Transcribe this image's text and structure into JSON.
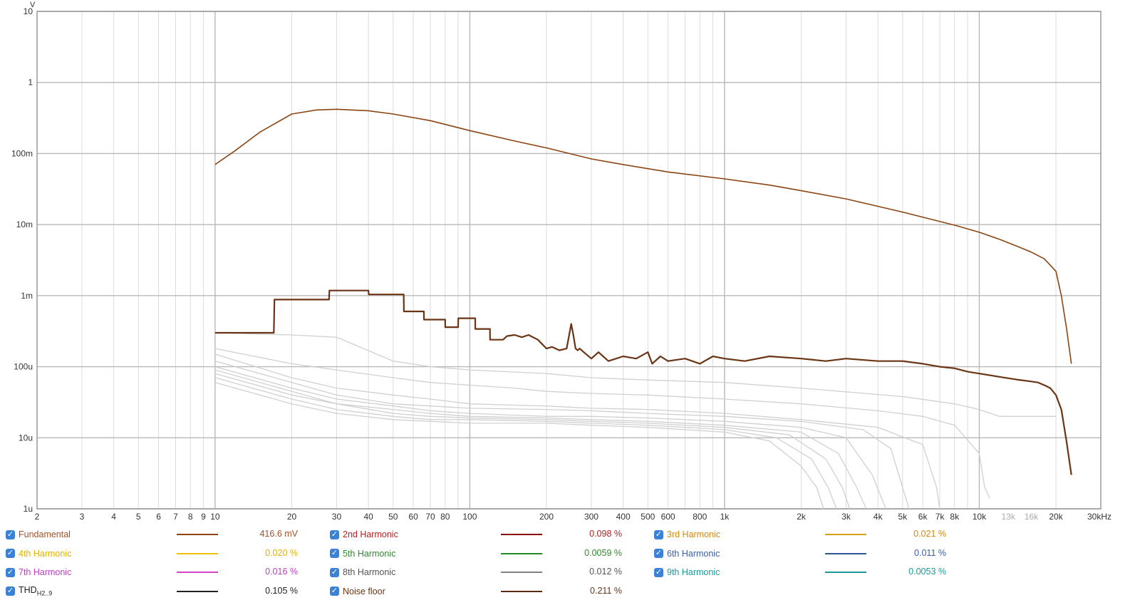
{
  "chart_data": {
    "type": "line",
    "x_scale": "log",
    "y_scale": "log",
    "xlim": [
      2,
      30000
    ],
    "ylim": [
      1e-06,
      10
    ],
    "y_unit_label": "V",
    "y_ticks": [
      {
        "v": 10,
        "label": "10"
      },
      {
        "v": 1,
        "label": "1"
      },
      {
        "v": 0.1,
        "label": "100m"
      },
      {
        "v": 0.01,
        "label": "10m"
      },
      {
        "v": 0.001,
        "label": "1m"
      },
      {
        "v": 0.0001,
        "label": "100u"
      },
      {
        "v": 1e-05,
        "label": "10u"
      },
      {
        "v": 1e-06,
        "label": "1u"
      }
    ],
    "x_ticks": [
      {
        "v": 2,
        "label": "2"
      },
      {
        "v": 3,
        "label": "3"
      },
      {
        "v": 4,
        "label": "4"
      },
      {
        "v": 5,
        "label": "5"
      },
      {
        "v": 6,
        "label": "6"
      },
      {
        "v": 7,
        "label": "7"
      },
      {
        "v": 8,
        "label": "8"
      },
      {
        "v": 9,
        "label": "9"
      },
      {
        "v": 10,
        "label": "10"
      },
      {
        "v": 20,
        "label": "20"
      },
      {
        "v": 30,
        "label": "30"
      },
      {
        "v": 40,
        "label": "40"
      },
      {
        "v": 50,
        "label": "50"
      },
      {
        "v": 60,
        "label": "60"
      },
      {
        "v": 70,
        "label": "70"
      },
      {
        "v": 80,
        "label": "80"
      },
      {
        "v": 100,
        "label": "100"
      },
      {
        "v": 200,
        "label": "200"
      },
      {
        "v": 300,
        "label": "300"
      },
      {
        "v": 400,
        "label": "400"
      },
      {
        "v": 500,
        "label": "500"
      },
      {
        "v": 600,
        "label": "600"
      },
      {
        "v": 800,
        "label": "800"
      },
      {
        "v": 1000,
        "label": "1k"
      },
      {
        "v": 2000,
        "label": "2k"
      },
      {
        "v": 3000,
        "label": "3k"
      },
      {
        "v": 4000,
        "label": "4k"
      },
      {
        "v": 5000,
        "label": "5k"
      },
      {
        "v": 6000,
        "label": "6k"
      },
      {
        "v": 7000,
        "label": "7k"
      },
      {
        "v": 8000,
        "label": "8k"
      },
      {
        "v": 10000,
        "label": "10k"
      },
      {
        "v": 13000,
        "label": "13k",
        "muted": true
      },
      {
        "v": 16000,
        "label": "16k",
        "muted": true
      },
      {
        "v": 20000,
        "label": "20k"
      },
      {
        "v": 30000,
        "label": "30kHz"
      }
    ],
    "grid": true,
    "series": [
      {
        "name": "Fundamental",
        "color": "#8b4513",
        "width": 1.6,
        "x": [
          10,
          12,
          15,
          20,
          25,
          30,
          40,
          50,
          70,
          100,
          150,
          200,
          300,
          400,
          600,
          1000,
          1500,
          2000,
          3000,
          5000,
          8000,
          10000,
          12000,
          14000,
          16000,
          18000,
          20000,
          21000,
          22000,
          23000
        ],
        "y": [
          0.07,
          0.11,
          0.2,
          0.36,
          0.41,
          0.42,
          0.4,
          0.36,
          0.29,
          0.21,
          0.15,
          0.12,
          0.084,
          0.07,
          0.055,
          0.044,
          0.036,
          0.03,
          0.023,
          0.015,
          0.0098,
          0.0078,
          0.0062,
          0.005,
          0.0041,
          0.0033,
          0.0022,
          0.001,
          0.00035,
          0.00011
        ]
      },
      {
        "name": "Noise floor",
        "color": "#6b3414",
        "width": 2.2,
        "x": [
          10,
          17,
          17.1,
          28,
          28.1,
          40,
          40.1,
          55,
          55.1,
          66,
          66.1,
          80,
          80.1,
          90,
          90.1,
          105,
          105.1,
          120,
          120.1,
          135,
          140,
          150,
          160,
          170,
          185,
          200,
          210,
          225,
          240,
          250,
          255,
          260,
          265,
          270,
          280,
          300,
          320,
          350,
          400,
          450,
          500,
          520,
          560,
          600,
          700,
          800,
          900,
          1000,
          1200,
          1500,
          2000,
          2500,
          3000,
          4000,
          5000,
          6000,
          7000,
          8000,
          9000,
          10000,
          12000,
          14000,
          16000,
          17000,
          18000,
          19000,
          20000,
          21000,
          22000,
          23000
        ],
        "y": [
          0.0003,
          0.0003,
          0.00088,
          0.00088,
          0.00118,
          0.00118,
          0.00104,
          0.00104,
          0.0006,
          0.0006,
          0.00046,
          0.00046,
          0.00036,
          0.00036,
          0.00048,
          0.00048,
          0.00034,
          0.00034,
          0.00024,
          0.00024,
          0.00027,
          0.00028,
          0.00026,
          0.00028,
          0.00024,
          0.00018,
          0.00019,
          0.00017,
          0.00018,
          0.0004,
          0.00028,
          0.00018,
          0.00017,
          0.00018,
          0.00016,
          0.00013,
          0.00016,
          0.00012,
          0.00014,
          0.00013,
          0.00016,
          0.00011,
          0.00014,
          0.00012,
          0.00013,
          0.00011,
          0.00014,
          0.00013,
          0.00012,
          0.00014,
          0.00013,
          0.00012,
          0.00013,
          0.00012,
          0.00012,
          0.00011,
          0.0001,
          9.5e-05,
          8.5e-05,
          8e-05,
          7.2e-05,
          6.6e-05,
          6.2e-05,
          6e-05,
          5.5e-05,
          5e-05,
          4e-05,
          2.5e-05,
          9e-06,
          3e-06
        ]
      },
      {
        "name": "2nd Harmonic",
        "color": "#d0d0d0",
        "width": 1.3,
        "x": [
          10,
          20,
          30,
          50,
          70,
          100,
          150,
          200,
          300,
          500,
          1000,
          2000,
          4000,
          6000,
          8000,
          10000,
          10500,
          11000
        ],
        "y": [
          0.00018,
          0.00011,
          9e-05,
          7e-05,
          6e-05,
          5.5e-05,
          5e-05,
          4.5e-05,
          4.2e-05,
          4e-05,
          3.5e-05,
          3e-05,
          2.4e-05,
          2e-05,
          1.5e-05,
          6e-06,
          2e-06,
          1.4e-06
        ]
      },
      {
        "name": "3rd Harmonic",
        "color": "#d0d0d0",
        "width": 1.3,
        "x": [
          10,
          20,
          30,
          50,
          70,
          100,
          200,
          300,
          500,
          1000,
          2000,
          4000,
          6000,
          6800,
          7000
        ],
        "y": [
          0.00015,
          7e-05,
          5e-05,
          4e-05,
          3.5e-05,
          3e-05,
          2.8e-05,
          2.6e-05,
          2.5e-05,
          2.2e-05,
          1.8e-05,
          1.4e-05,
          8e-06,
          2e-06,
          1e-06
        ]
      },
      {
        "name": "4th Harmonic",
        "color": "#d0d0d0",
        "width": 1.3,
        "x": [
          10,
          20,
          30,
          50,
          70,
          100,
          200,
          300,
          500,
          1000,
          2000,
          3500,
          4500,
          5000,
          5300
        ],
        "y": [
          0.00012,
          6e-05,
          4e-05,
          3e-05,
          2.8e-05,
          2.6e-05,
          2.5e-05,
          2.4e-05,
          2.2e-05,
          2e-05,
          1.7e-05,
          1.3e-05,
          7e-06,
          2e-06,
          1e-06
        ]
      },
      {
        "name": "5th Harmonic",
        "color": "#d0d0d0",
        "width": 1.3,
        "x": [
          10,
          20,
          30,
          50,
          70,
          100,
          200,
          300,
          500,
          1000,
          2000,
          3000,
          3800,
          4300
        ],
        "y": [
          0.0001,
          5e-05,
          3.5e-05,
          2.8e-05,
          2.4e-05,
          2.2e-05,
          2e-05,
          2e-05,
          1.9e-05,
          1.7e-05,
          1.4e-05,
          1e-05,
          3e-06,
          1e-06
        ]
      },
      {
        "name": "6th Harmonic",
        "color": "#d0d0d0",
        "width": 1.3,
        "x": [
          10,
          20,
          30,
          50,
          70,
          100,
          200,
          300,
          500,
          1000,
          2000,
          2800,
          3300,
          3600
        ],
        "y": [
          9e-05,
          4.5e-05,
          3e-05,
          2.5e-05,
          2.2e-05,
          2e-05,
          1.9e-05,
          1.8e-05,
          1.7e-05,
          1.5e-05,
          1.2e-05,
          6e-06,
          2e-06,
          1e-06
        ]
      },
      {
        "name": "7th Harmonic",
        "color": "#d0d0d0",
        "width": 1.3,
        "x": [
          10,
          20,
          30,
          50,
          70,
          100,
          200,
          300,
          500,
          1000,
          1800,
          2500,
          2900,
          3100
        ],
        "y": [
          8e-05,
          4e-05,
          3e-05,
          2.2e-05,
          2e-05,
          1.9e-05,
          1.8e-05,
          1.7e-05,
          1.6e-05,
          1.4e-05,
          1.1e-05,
          5e-06,
          2e-06,
          1e-06
        ]
      },
      {
        "name": "8th Harmonic",
        "color": "#d0d0d0",
        "width": 1.3,
        "x": [
          10,
          20,
          30,
          50,
          70,
          100,
          200,
          300,
          500,
          1000,
          1600,
          2200,
          2550,
          2750
        ],
        "y": [
          7e-05,
          3.5e-05,
          2.5e-05,
          2e-05,
          1.8e-05,
          1.8e-05,
          1.7e-05,
          1.6e-05,
          1.5e-05,
          1.3e-05,
          1e-05,
          5e-06,
          2e-06,
          1e-06
        ]
      },
      {
        "name": "9th Harmonic",
        "color": "#d0d0d0",
        "width": 1.3,
        "x": [
          10,
          20,
          30,
          50,
          70,
          100,
          200,
          300,
          500,
          1000,
          1500,
          2000,
          2300,
          2450
        ],
        "y": [
          6e-05,
          3e-05,
          2.2e-05,
          1.8e-05,
          1.7e-05,
          1.6e-05,
          1.6e-05,
          1.5e-05,
          1.4e-05,
          1.2e-05,
          9e-06,
          4e-06,
          2e-06,
          1e-06
        ]
      },
      {
        "name": "THD",
        "color": "#d0d0d0",
        "width": 1.3,
        "x": [
          10,
          20,
          30,
          50,
          70,
          100,
          200,
          300,
          500,
          1000,
          2000,
          5000,
          8000,
          10000,
          12000,
          16000,
          20000
        ],
        "y": [
          0.0003,
          0.00028,
          0.00026,
          0.00012,
          0.0001,
          9e-05,
          8e-05,
          7e-05,
          6.5e-05,
          6e-05,
          5e-05,
          3.8e-05,
          3e-05,
          2.5e-05,
          2e-05,
          2e-05,
          2e-05
        ]
      }
    ]
  },
  "legend": {
    "rows": [
      [
        {
          "name": "Fundamental",
          "label": "Fundamental",
          "label_color": "#a0522d",
          "line_color": "#8b4513",
          "value": "416.6 mV",
          "value_color": "#a0522d"
        },
        {
          "name": "2nd Harmonic",
          "label": "2nd Harmonic",
          "label_color": "#b22222",
          "line_color": "#8b0000",
          "value": "0.098 %",
          "value_color": "#b22222"
        },
        {
          "name": "3rd Harmonic",
          "label": "3rd Harmonic",
          "label_color": "#d08a10",
          "line_color": "#d4a017",
          "value": "0.021 %",
          "value_color": "#d08a10"
        }
      ],
      [
        {
          "name": "4th Harmonic",
          "label": "4th Harmonic",
          "label_color": "#e0b400",
          "line_color": "#f0c000",
          "value": "0.020 %",
          "value_color": "#e0b400"
        },
        {
          "name": "5th Harmonic",
          "label": "5th Harmonic",
          "label_color": "#2e8b2e",
          "line_color": "#228b22",
          "value": "0.0059 %",
          "value_color": "#2e8b2e"
        },
        {
          "name": "6th Harmonic",
          "label": "6th Harmonic",
          "label_color": "#3a5fa8",
          "line_color": "#2f5597",
          "value": "0.011 %",
          "value_color": "#3a5fa8"
        }
      ],
      [
        {
          "name": "7th Harmonic",
          "label": "7th Harmonic",
          "label_color": "#c040c0",
          "line_color": "#cc44cc",
          "value": "0.016 %",
          "value_color": "#c040c0"
        },
        {
          "name": "8th Harmonic",
          "label": "8th Harmonic",
          "label_color": "#555555",
          "line_color": "#808080",
          "value": "0.012 %",
          "value_color": "#555555"
        },
        {
          "name": "9th Harmonic",
          "label": "9th Harmonic",
          "label_color": "#1a9a9a",
          "line_color": "#1a9a9a",
          "value": "0.0053 %",
          "value_color": "#1a9a9a"
        }
      ],
      [
        {
          "name": "THD",
          "label": "THD",
          "label_sub": "H2..9",
          "label_color": "#222222",
          "line_color": "#222222",
          "value": "0.105 %",
          "value_color": "#222222"
        },
        {
          "name": "Noise floor",
          "label": "Noise floor",
          "label_color": "#6b3414",
          "line_color": "#5a2a0e",
          "value": "0.211 %",
          "value_color": "#6b3414"
        }
      ]
    ]
  }
}
